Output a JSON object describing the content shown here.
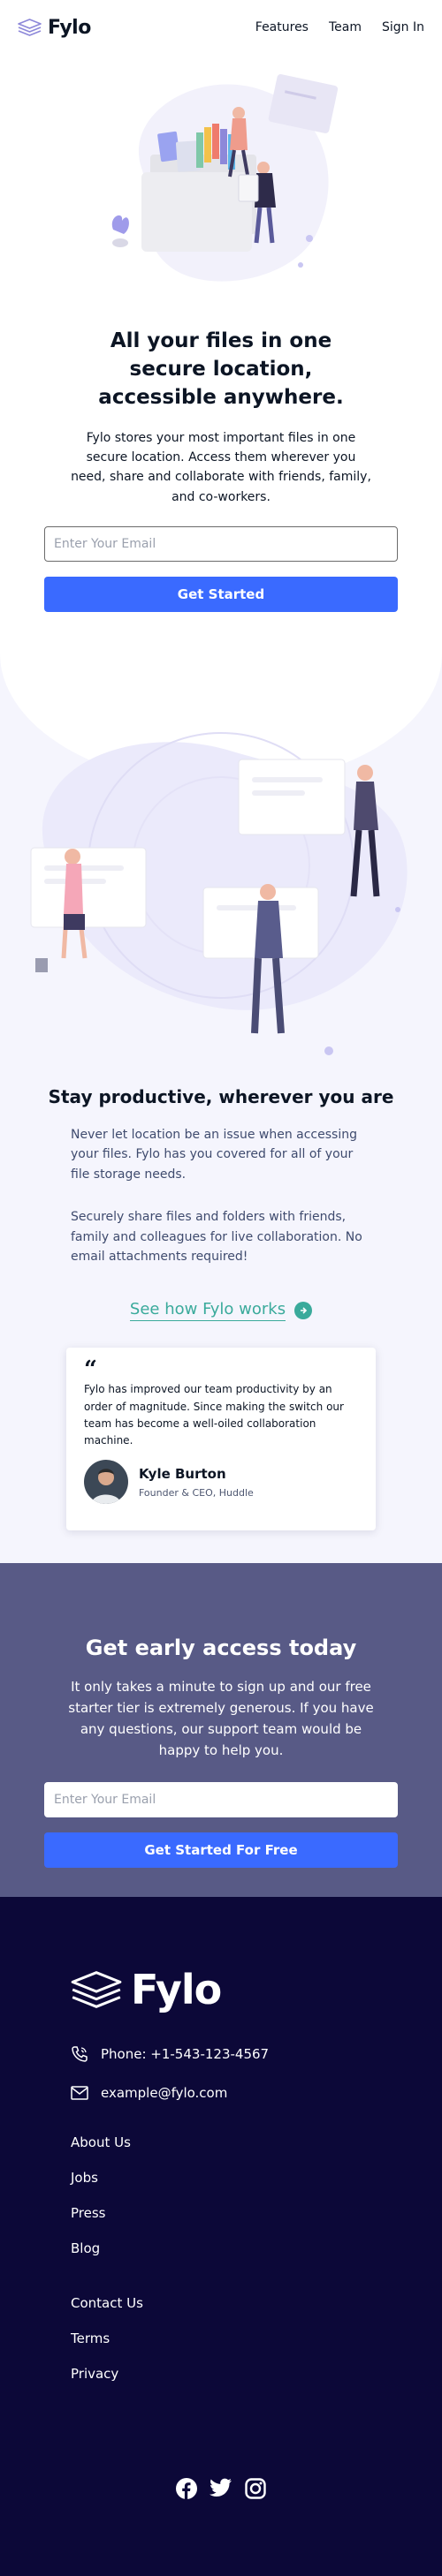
{
  "header": {
    "brand": "Fylo",
    "nav": [
      "Features",
      "Team",
      "Sign In"
    ]
  },
  "hero": {
    "title": "All your files in one secure location, accessible anywhere.",
    "description": "Fylo stores your most important files in one secure location. Access them wherever you need, share and collaborate with friends, family, and co-workers.",
    "email_placeholder": "Enter Your Email",
    "cta": "Get Started"
  },
  "productive": {
    "title": "Stay productive, wherever you are",
    "paragraphs": [
      "Never let location be an issue when accessing your files. Fylo has you covered for all of your file storage needs.",
      "Securely share files and folders with friends, family and colleagues for live collaboration. No email attachments required!"
    ],
    "link": "See how Fylo works",
    "testimonial": {
      "quote": "Fylo has improved our team productivity by an order of magnitude. Since making the switch our team has become a well-oiled collaboration machine.",
      "name": "Kyle Burton",
      "role": "Founder & CEO, Huddle"
    }
  },
  "early_access": {
    "title": "Get early access today",
    "description": "It only takes a minute to sign up and our free starter tier is extremely generous. If you have any questions, our support team would be happy to help you.",
    "email_placeholder": "Enter Your Email",
    "cta": "Get Started For Free"
  },
  "footer": {
    "brand": "Fylo",
    "phone": "Phone: +1-543-123-4567",
    "email": "example@fylo.com",
    "links_primary": [
      "About Us",
      "Jobs",
      "Press",
      "Blog"
    ],
    "links_secondary": [
      "Contact Us",
      "Terms",
      "Privacy"
    ],
    "social_icons": [
      "facebook-icon",
      "twitter-icon",
      "instagram-icon"
    ]
  },
  "colors": {
    "primary_button": "#3a6aff",
    "accent_teal": "#3aaa9b",
    "early_access_bg": "#585a86",
    "footer_bg": "#0c0838",
    "navy_text": "#0c1524"
  }
}
